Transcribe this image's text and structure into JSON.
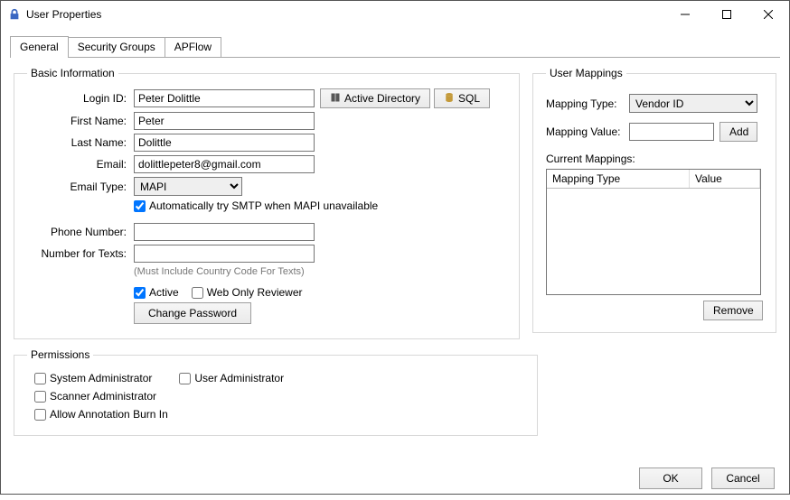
{
  "window": {
    "title": "User Properties"
  },
  "tabs": {
    "general": "General",
    "security_groups": "Security Groups",
    "apflow": "APFlow"
  },
  "basic_info": {
    "legend": "Basic Information",
    "labels": {
      "login_id": "Login ID:",
      "first_name": "First Name:",
      "last_name": "Last Name:",
      "email": "Email:",
      "email_type": "Email Type:",
      "phone": "Phone Number:",
      "texts": "Number for Texts:"
    },
    "values": {
      "login_id": "Peter Dolittle",
      "first_name": "Peter",
      "last_name": "Dolittle",
      "email": "dolittlepeter8@gmail.com",
      "email_type": "MAPI",
      "phone": "",
      "texts": ""
    },
    "buttons": {
      "active_directory": "Active Directory",
      "sql": "SQL",
      "change_password": "Change Password"
    },
    "checkboxes": {
      "smtp": "Automatically try SMTP when MAPI unavailable",
      "active": "Active",
      "web_only": "Web Only Reviewer"
    },
    "note": "(Must Include Country Code For Texts)"
  },
  "user_mappings": {
    "legend": "User Mappings",
    "labels": {
      "type": "Mapping Type:",
      "value": "Mapping Value:",
      "current": "Current Mappings:"
    },
    "selected_type": "Vendor ID",
    "value": "",
    "buttons": {
      "add": "Add",
      "remove": "Remove"
    },
    "columns": {
      "type": "Mapping Type",
      "value": "Value"
    }
  },
  "permissions": {
    "legend": "Permissions",
    "items": {
      "sysadmin": "System Administrator",
      "useradmin": "User Administrator",
      "scanadmin": "Scanner Administrator",
      "burn": "Allow Annotation Burn In"
    }
  },
  "footer": {
    "ok": "OK",
    "cancel": "Cancel"
  }
}
